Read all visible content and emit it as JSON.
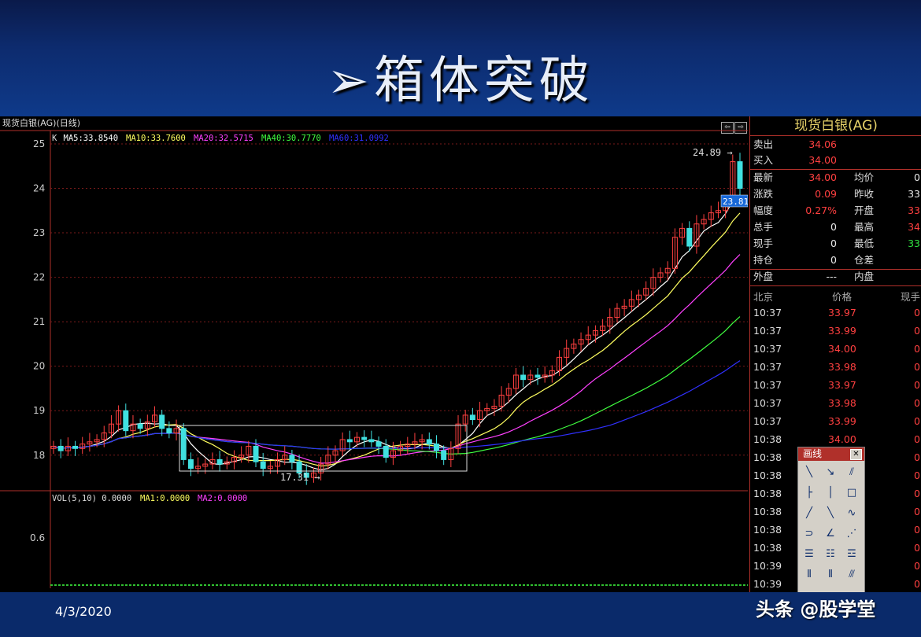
{
  "slide": {
    "title": "➢箱体突破",
    "date": "4/3/2020",
    "watermark": "头条 @股学堂"
  },
  "chart": {
    "header": "现货白银(AG)(日线)",
    "legend": [
      {
        "text": "K",
        "color": "#dddddd"
      },
      {
        "text": "MA5:33.8540",
        "color": "#ffffff"
      },
      {
        "text": "MA10:33.7600",
        "color": "#ffff60"
      },
      {
        "text": "MA20:32.5715",
        "color": "#ff40ff"
      },
      {
        "text": "MA40:30.7770",
        "color": "#40ff40"
      },
      {
        "text": "MA60:31.0992",
        "color": "#3030ff"
      }
    ],
    "y_ticks": [
      "25",
      "24",
      "23",
      "22",
      "21",
      "20",
      "19",
      "18"
    ],
    "high_label": "24.89",
    "low_label": "17.31",
    "last_label": "23.81",
    "vol_legend": [
      {
        "text": "VOL(5,10) 0.0000",
        "color": "#dddddd"
      },
      {
        "text": "MA1:0.0000",
        "color": "#ffff60"
      },
      {
        "text": "MA2:0.0000",
        "color": "#ff40ff"
      }
    ],
    "vol_tick": "0.6"
  },
  "chart_data": {
    "type": "candlestick",
    "y_range": [
      17.2,
      25.3
    ],
    "closes": [
      18.2,
      18.1,
      18.2,
      18.15,
      18.25,
      18.3,
      18.35,
      18.5,
      18.7,
      19.0,
      18.55,
      18.7,
      18.6,
      18.75,
      18.9,
      18.6,
      18.5,
      18.6,
      17.9,
      17.7,
      17.75,
      17.8,
      17.9,
      17.8,
      17.85,
      17.95,
      18.0,
      18.2,
      17.85,
      17.7,
      17.75,
      17.9,
      18.0,
      17.85,
      17.6,
      17.5,
      17.6,
      17.8,
      18.0,
      18.1,
      18.35,
      18.3,
      18.4,
      18.35,
      18.3,
      18.2,
      17.95,
      18.1,
      18.2,
      18.25,
      18.3,
      18.35,
      18.25,
      18.1,
      17.9,
      18.15,
      18.7,
      18.9,
      18.8,
      19.0,
      19.05,
      19.1,
      19.35,
      19.5,
      19.8,
      19.7,
      19.8,
      19.75,
      19.8,
      19.9,
      20.2,
      20.4,
      20.5,
      20.6,
      20.7,
      20.8,
      20.9,
      21.1,
      21.3,
      21.35,
      21.5,
      21.6,
      21.75,
      22.0,
      22.1,
      22.2,
      22.9,
      23.1,
      22.7,
      23.2,
      23.3,
      23.45,
      23.5,
      23.7,
      24.6,
      24.0
    ],
    "ma_series": [
      "MA5",
      "MA10",
      "MA20",
      "MA40",
      "MA60"
    ]
  },
  "quote": {
    "title": "现货白银(AG)",
    "rows": [
      {
        "l": "卖出",
        "v": "34.06",
        "vc": "red"
      },
      {
        "l": "买入",
        "v": "34.00",
        "vc": "red"
      },
      {
        "l": "最新",
        "v": "34.00",
        "vc": "red",
        "l2": "均价",
        "v2": "0",
        "v2c": "white"
      },
      {
        "l": "涨跌",
        "v": "0.09",
        "vc": "red",
        "l2": "昨收",
        "v2": "33",
        "v2c": "white"
      },
      {
        "l": "幅度",
        "v": "0.27%",
        "vc": "red",
        "l2": "开盘",
        "v2": "33",
        "v2c": "red"
      },
      {
        "l": "总手",
        "v": "0",
        "vc": "white",
        "l2": "最高",
        "v2": "34",
        "v2c": "red"
      },
      {
        "l": "现手",
        "v": "0",
        "vc": "white",
        "l2": "最低",
        "v2": "33",
        "v2c": "green"
      },
      {
        "l": "持仓",
        "v": "0",
        "vc": "white",
        "l2": "仓差",
        "v2": "",
        "v2c": "white"
      },
      {
        "l": "外盘",
        "v": "---",
        "vc": "white",
        "l2": "内盘",
        "v2": "",
        "v2c": "white"
      }
    ],
    "tick_header": {
      "time": "北京",
      "price": "价格",
      "qty": "现手"
    },
    "ticks": [
      {
        "t": "10:37",
        "p": "33.97",
        "q": "0"
      },
      {
        "t": "10:37",
        "p": "33.99",
        "q": "0"
      },
      {
        "t": "10:37",
        "p": "34.00",
        "q": "0"
      },
      {
        "t": "10:37",
        "p": "33.98",
        "q": "0"
      },
      {
        "t": "10:37",
        "p": "33.97",
        "q": "0"
      },
      {
        "t": "10:37",
        "p": "33.98",
        "q": "0"
      },
      {
        "t": "10:37",
        "p": "33.99",
        "q": "0"
      },
      {
        "t": "10:38",
        "p": "34.00",
        "q": "0"
      },
      {
        "t": "10:38",
        "p": "",
        "q": "0"
      },
      {
        "t": "10:38",
        "p": "",
        "q": "0"
      },
      {
        "t": "10:38",
        "p": "",
        "q": "0"
      },
      {
        "t": "10:38",
        "p": "",
        "q": "0"
      },
      {
        "t": "10:38",
        "p": "",
        "q": "0"
      },
      {
        "t": "10:38",
        "p": "",
        "q": "0"
      },
      {
        "t": "10:39",
        "p": "",
        "q": "0"
      },
      {
        "t": "10:39",
        "p": "",
        "q": "0"
      }
    ]
  },
  "draw_panel": {
    "title": "画线",
    "close": "✕",
    "tools": [
      {
        "g": "╲",
        "n": "line-tool-icon"
      },
      {
        "g": "↘",
        "n": "arrow-line-icon"
      },
      {
        "g": "⫽",
        "n": "parallel-line-icon"
      },
      {
        "g": "├",
        "n": "horizontal-line-icon"
      },
      {
        "g": "│",
        "n": "vertical-line-icon"
      },
      {
        "g": "□",
        "n": "rectangle-icon"
      },
      {
        "g": "╱",
        "n": "ray-icon"
      },
      {
        "g": "╲",
        "n": "segment-icon"
      },
      {
        "g": "∿",
        "n": "wave-icon"
      },
      {
        "g": "⊃",
        "n": "arc-icon"
      },
      {
        "g": "∠",
        "n": "angle-icon"
      },
      {
        "g": "⋰",
        "n": "fan-icon"
      },
      {
        "g": "☰",
        "n": "fibonacci-icon"
      },
      {
        "g": "☷",
        "n": "gann-icon"
      },
      {
        "g": "☲",
        "n": "percent-line-icon"
      },
      {
        "g": "⦀",
        "n": "period-line-icon"
      },
      {
        "g": "⦀",
        "n": "fib-period-icon"
      },
      {
        "g": "⫻",
        "n": "channel-icon"
      }
    ]
  }
}
